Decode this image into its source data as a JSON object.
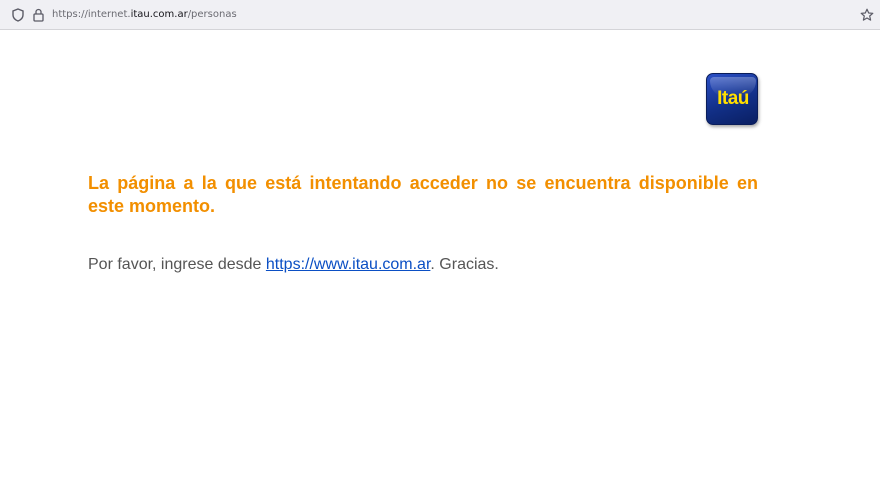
{
  "browser": {
    "url_prefix": "https://internet.",
    "url_domain": "itau.com.ar",
    "url_path": "/personas"
  },
  "logo": {
    "text": "Itaú"
  },
  "message": {
    "error": "La página a la que está intentando acceder no se encuentra disponible en este momento.",
    "instruction_before": "Por favor, ingrese desde ",
    "link_text": "https://www.itau.com.ar",
    "instruction_after": ". Gracias."
  },
  "colors": {
    "error_text": "#f28f00",
    "link": "#0b4fc4",
    "logo_background": "#123088",
    "logo_text": "#ffde00"
  },
  "icons": [
    "shield-icon",
    "lock-icon",
    "star-icon"
  ]
}
